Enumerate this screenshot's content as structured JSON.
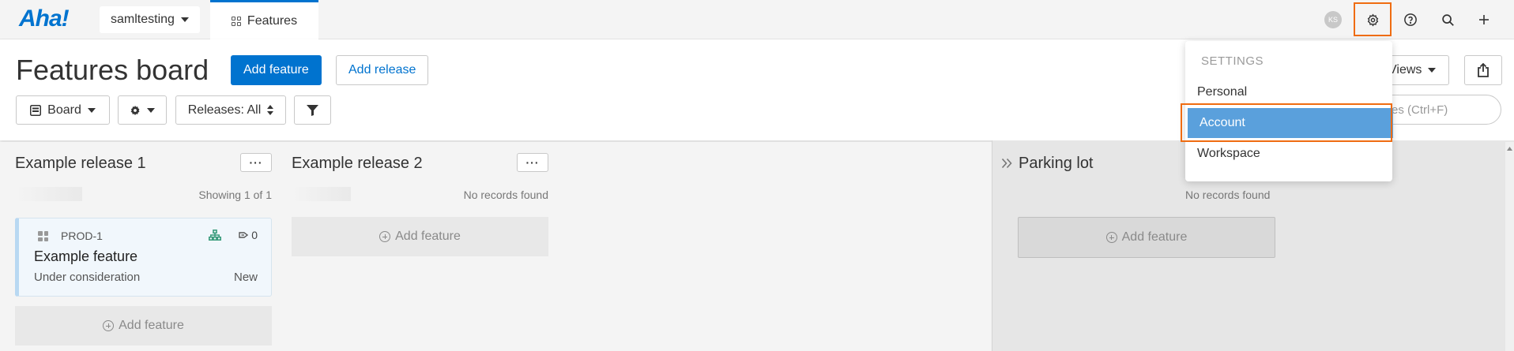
{
  "nav": {
    "logo": "Aha!",
    "workspace": "samltesting",
    "tab": "Features",
    "avatar": "KS"
  },
  "header": {
    "title": "Features board",
    "add_feature": "Add feature",
    "add_release": "Add release",
    "board_label": "Board",
    "releases_filter": "Releases: All",
    "views": "Views",
    "search_placeholder": "es (Ctrl+F)"
  },
  "columns": [
    {
      "title": "Example release 1",
      "count": "Showing 1 of 1",
      "add": "Add feature",
      "card": {
        "id": "PROD-1",
        "title": "Example feature",
        "status": "Under consideration",
        "workflow": "New",
        "votes": "0"
      }
    },
    {
      "title": "Example release 2",
      "count": "No records found",
      "add": "Add feature"
    }
  ],
  "parking": {
    "title": "Parking lot",
    "count": "No records found",
    "add": "Add feature"
  },
  "settings_menu": {
    "heading": "SETTINGS",
    "items": [
      "Personal",
      "Account",
      "Workspace"
    ],
    "active": "Account"
  },
  "colors": {
    "brand": "#0073cf",
    "highlight": "#ef6c11",
    "active_item": "#5aa0dc"
  }
}
